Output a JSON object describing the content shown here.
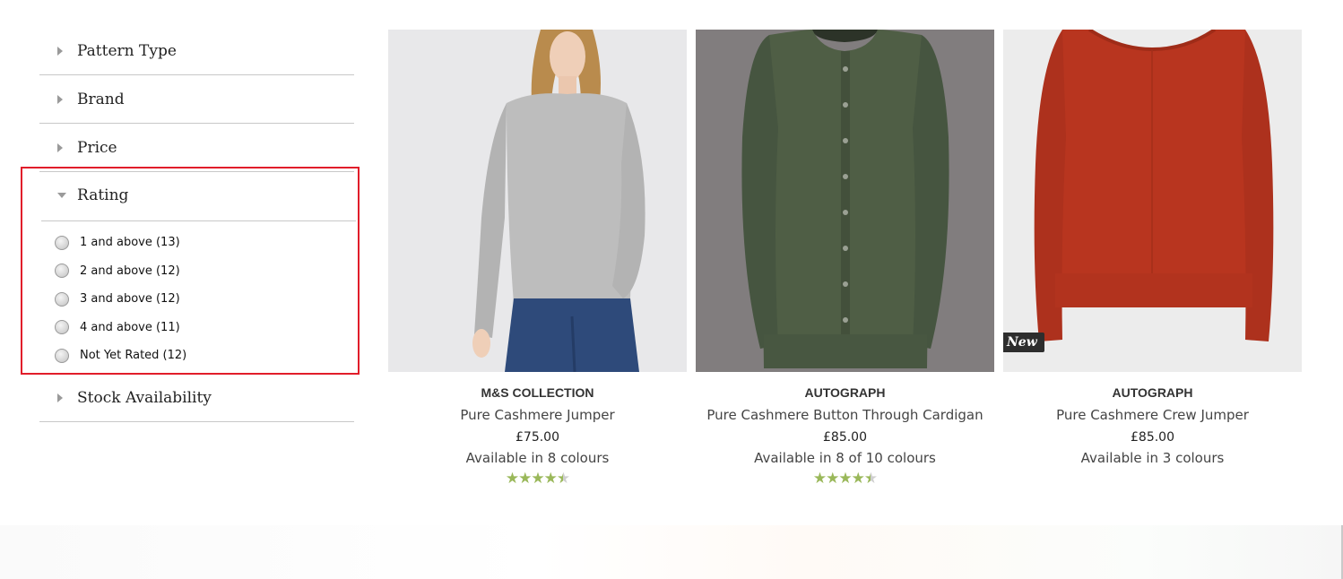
{
  "filters": {
    "facets_top": [
      {
        "label": "Pattern Type"
      },
      {
        "label": "Brand"
      },
      {
        "label": "Price"
      }
    ],
    "rating": {
      "label": "Rating",
      "highlight_color": "#e11d2a",
      "options": [
        {
          "label": "1 and above (13)"
        },
        {
          "label": "2 and above (12)"
        },
        {
          "label": "3 and above (12)"
        },
        {
          "label": "4 and above (11)"
        },
        {
          "label": "Not Yet Rated (12)"
        }
      ]
    },
    "facets_bottom": [
      {
        "label": "Stock Availability"
      }
    ]
  },
  "products": [
    {
      "brand": "M&S COLLECTION",
      "name": "Pure Cashmere Jumper",
      "price": "£75.00",
      "colours": "Available in 8 colours",
      "rating": 4.5,
      "badge": ""
    },
    {
      "brand": "AUTOGRAPH",
      "name": "Pure Cashmere Button Through Cardigan",
      "price": "£85.00",
      "colours": "Available in 8 of 10 colours",
      "rating": 4.5,
      "badge": ""
    },
    {
      "brand": "AUTOGRAPH",
      "name": "Pure Cashmere Crew Jumper",
      "price": "£85.00",
      "colours": "Available in 3 colours",
      "rating": null,
      "badge": "New"
    }
  ],
  "colors": {
    "star": "#9ab85a",
    "sweater_grey": "#bfbfbf",
    "cardigan_green": "#4e5e44",
    "jumper_red": "#b8351f"
  }
}
